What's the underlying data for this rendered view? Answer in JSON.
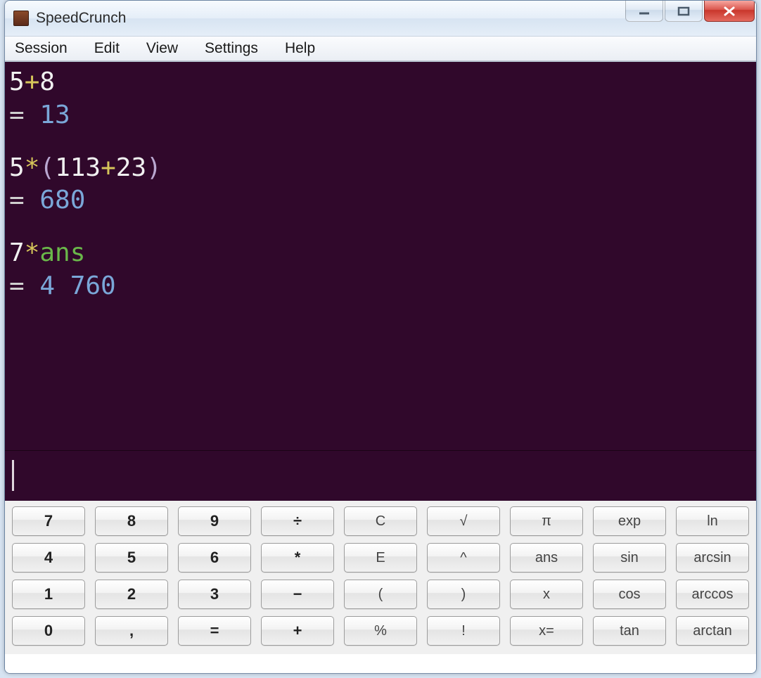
{
  "window": {
    "title": "SpeedCrunch"
  },
  "menu": {
    "session": "Session",
    "edit": "Edit",
    "view": "View",
    "settings": "Settings",
    "help": "Help"
  },
  "history": [
    {
      "expr": [
        {
          "cls": "tok-num",
          "t": "5"
        },
        {
          "cls": "tok-op",
          "t": "+"
        },
        {
          "cls": "tok-num",
          "t": "8"
        }
      ],
      "result": "13"
    },
    {
      "expr": [
        {
          "cls": "tok-num",
          "t": "5"
        },
        {
          "cls": "tok-op",
          "t": "*"
        },
        {
          "cls": "tok-par",
          "t": "("
        },
        {
          "cls": "tok-num",
          "t": "113"
        },
        {
          "cls": "tok-op",
          "t": "+"
        },
        {
          "cls": "tok-num",
          "t": "23"
        },
        {
          "cls": "tok-par",
          "t": ")"
        }
      ],
      "result": "680"
    },
    {
      "expr": [
        {
          "cls": "tok-num",
          "t": "7"
        },
        {
          "cls": "tok-op",
          "t": "*"
        },
        {
          "cls": "tok-ans",
          "t": "ans"
        }
      ],
      "result": "4 760"
    }
  ],
  "input": {
    "value": ""
  },
  "keypad": {
    "rows": [
      [
        {
          "name": "key-7",
          "label": "7",
          "cls": "num"
        },
        {
          "name": "key-8",
          "label": "8",
          "cls": "num"
        },
        {
          "name": "key-9",
          "label": "9",
          "cls": "num"
        },
        {
          "name": "key-divide",
          "label": "÷",
          "cls": "num"
        },
        {
          "name": "key-clear",
          "label": "C",
          "cls": "dim"
        },
        {
          "name": "key-sqrt",
          "label": "√",
          "cls": "dim"
        },
        {
          "name": "key-pi",
          "label": "π",
          "cls": "dim"
        },
        {
          "name": "key-exp",
          "label": "exp",
          "cls": "dim"
        },
        {
          "name": "key-ln",
          "label": "ln",
          "cls": "dim"
        }
      ],
      [
        {
          "name": "key-4",
          "label": "4",
          "cls": "num"
        },
        {
          "name": "key-5",
          "label": "5",
          "cls": "num"
        },
        {
          "name": "key-6",
          "label": "6",
          "cls": "num"
        },
        {
          "name": "key-multiply",
          "label": "*",
          "cls": "num"
        },
        {
          "name": "key-e",
          "label": "E",
          "cls": "dim"
        },
        {
          "name": "key-power",
          "label": "^",
          "cls": "dim"
        },
        {
          "name": "key-ans",
          "label": "ans",
          "cls": "dim"
        },
        {
          "name": "key-sin",
          "label": "sin",
          "cls": "dim"
        },
        {
          "name": "key-arcsin",
          "label": "arcsin",
          "cls": "dim"
        }
      ],
      [
        {
          "name": "key-1",
          "label": "1",
          "cls": "num"
        },
        {
          "name": "key-2",
          "label": "2",
          "cls": "num"
        },
        {
          "name": "key-3",
          "label": "3",
          "cls": "num"
        },
        {
          "name": "key-minus",
          "label": "−",
          "cls": "num"
        },
        {
          "name": "key-lparen",
          "label": "(",
          "cls": "dim"
        },
        {
          "name": "key-rparen",
          "label": ")",
          "cls": "dim"
        },
        {
          "name": "key-x",
          "label": "x",
          "cls": "dim"
        },
        {
          "name": "key-cos",
          "label": "cos",
          "cls": "dim"
        },
        {
          "name": "key-arccos",
          "label": "arccos",
          "cls": "dim"
        }
      ],
      [
        {
          "name": "key-0",
          "label": "0",
          "cls": "num"
        },
        {
          "name": "key-comma",
          "label": ",",
          "cls": "num"
        },
        {
          "name": "key-equals",
          "label": "=",
          "cls": "num"
        },
        {
          "name": "key-plus",
          "label": "+",
          "cls": "num"
        },
        {
          "name": "key-percent",
          "label": "%",
          "cls": "dim"
        },
        {
          "name": "key-factorial",
          "label": "!",
          "cls": "dim"
        },
        {
          "name": "key-assign",
          "label": "x=",
          "cls": "dim"
        },
        {
          "name": "key-tan",
          "label": "tan",
          "cls": "dim"
        },
        {
          "name": "key-arctan",
          "label": "arctan",
          "cls": "dim"
        }
      ]
    ]
  }
}
